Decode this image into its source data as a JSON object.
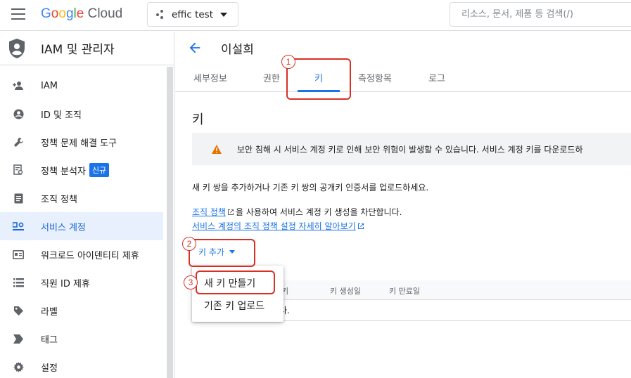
{
  "topbar": {
    "logo_google": "Google",
    "logo_cloud": "Cloud",
    "project": "effic test",
    "search_placeholder": "리소스, 문서, 제품 등 검색(/)"
  },
  "sidebar": {
    "title": "IAM 및 관리자",
    "items": [
      {
        "label": "IAM",
        "icon": "person-add-icon"
      },
      {
        "label": "ID 및 조직",
        "icon": "account-circle-icon"
      },
      {
        "label": "정책 문제 해결 도구",
        "icon": "wrench-icon"
      },
      {
        "label": "정책 분석자",
        "icon": "policy-analyzer-icon",
        "badge": "신규"
      },
      {
        "label": "조직 정책",
        "icon": "document-icon"
      },
      {
        "label": "서비스 계정",
        "icon": "service-account-icon",
        "active": true
      },
      {
        "label": "워크로드 아이덴티티 제휴",
        "icon": "id-card-icon"
      },
      {
        "label": "직원 ID 제휴",
        "icon": "list-icon"
      },
      {
        "label": "라벨",
        "icon": "tag-icon"
      },
      {
        "label": "태그",
        "icon": "chevron-tag-icon"
      },
      {
        "label": "설정",
        "icon": "gear-icon"
      }
    ]
  },
  "main": {
    "title": "이설희",
    "tabs": [
      "세부정보",
      "권한",
      "키",
      "측정항목",
      "로그"
    ],
    "active_tab": "키",
    "section_title": "키",
    "warning": "보안 침해 시 서비스 계정 키로 인해 보안 위험이 발생할 수 있습니다. 서비스 계정 키를 다운로드하",
    "description": "새 키 쌍을 추가하거나 기존 키 쌍의 공개키 인증서를 업로드하세요.",
    "policy_link": "조직 정책",
    "policy_text": "을 사용하여 서비스 계정 키 생성을 차단합니다.",
    "learn_link": "서비스 계정의 조직 정책 설정 자세히 알아보기",
    "add_key": "키 추가",
    "table": {
      "columns": [
        "키",
        "키 생성일",
        "키 만료일"
      ],
      "empty": "다."
    },
    "menu": [
      "새 키 만들기",
      "기존 키 업로드"
    ]
  },
  "annotations": [
    "1",
    "2",
    "3"
  ],
  "colors": {
    "accent": "#1a73e8",
    "annotation": "#d93025",
    "warning": "#e37400"
  }
}
